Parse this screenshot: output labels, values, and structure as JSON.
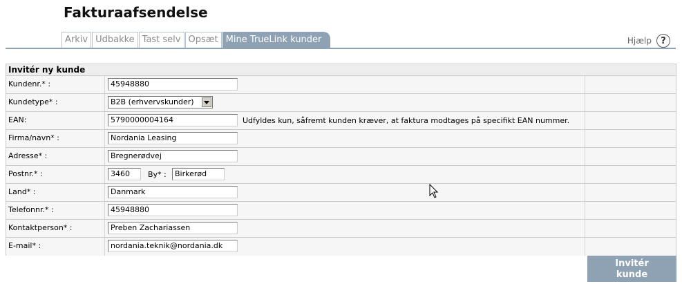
{
  "page": {
    "title": "Fakturaafsendelse"
  },
  "tabs": [
    {
      "label": "Arkiv",
      "active": false
    },
    {
      "label": "Udbakke",
      "active": false
    },
    {
      "label": "Tast selv",
      "active": false
    },
    {
      "label": "Opsæt",
      "active": false
    },
    {
      "label": "Mine TrueLink kunder",
      "active": true
    }
  ],
  "help": {
    "label": "Hjælp",
    "icon": "question-icon",
    "symbol": "?"
  },
  "form": {
    "title": "Invitér ny kunde",
    "fields": {
      "kundenr": {
        "label": "Kundenr.* :",
        "value": "45948880"
      },
      "kundetype": {
        "label": "Kundetype* :",
        "value": "B2B (erhvervskunder)"
      },
      "ean": {
        "label": "EAN:",
        "value": "5790000004164",
        "note": "Udfyldes kun, såfremt kunden kræver, at faktura modtages på specifikt EAN nummer."
      },
      "firma": {
        "label": "Firma/navn* :",
        "value": "Nordania Leasing"
      },
      "adresse": {
        "label": "Adresse* :",
        "value": "Bregnerødvej"
      },
      "postnr": {
        "label": "Postnr.* :",
        "value": "3460"
      },
      "by": {
        "label": "By* :",
        "value": "Birkerød"
      },
      "land": {
        "label": "Land* :",
        "value": "Danmark"
      },
      "telefon": {
        "label": "Telefonnr.* :",
        "value": "45948880"
      },
      "kontakt": {
        "label": "Kontaktperson* :",
        "value": "Preben Zachariassen"
      },
      "email": {
        "label": "E-mail* :",
        "value": "nordania.teknik@nordania.dk"
      }
    },
    "submit": {
      "line1": "Invitér",
      "line2": "kunde"
    }
  },
  "colors": {
    "accent": "#8ea2b4",
    "row_bg": "#f6f6f6",
    "header_bg": "#eeeeee"
  }
}
